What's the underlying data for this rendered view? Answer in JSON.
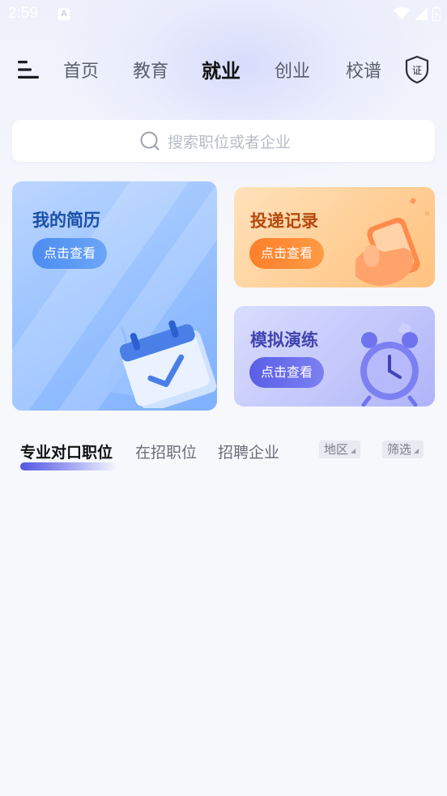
{
  "status_bar": {
    "time": "2:59",
    "notification_glyph": "A"
  },
  "nav": {
    "tabs": [
      {
        "label": "首页",
        "active": false
      },
      {
        "label": "教育",
        "active": false
      },
      {
        "label": "就业",
        "active": true
      },
      {
        "label": "创业",
        "active": false
      },
      {
        "label": "校谱",
        "active": false
      }
    ],
    "cert_label": "证"
  },
  "search": {
    "placeholder": "搜索职位或者企业"
  },
  "cards": {
    "resume": {
      "title": "我的简历",
      "button": "点击查看"
    },
    "delivery": {
      "title": "投递记录",
      "button": "点击查看"
    },
    "practice": {
      "title": "模拟演练",
      "button": "点击查看"
    }
  },
  "list_tabs": {
    "tabs": [
      {
        "label": "专业对口职位",
        "active": true
      },
      {
        "label": "在招职位",
        "active": false
      },
      {
        "label": "招聘企业",
        "active": false
      }
    ],
    "filters": {
      "region": "地区",
      "screen": "筛选"
    }
  },
  "colors": {
    "accent": "#5356e0",
    "resume_title": "#1b4fa6",
    "delivery_title": "#b44a10",
    "practice_title": "#4144b0"
  },
  "icons": [
    "menu-icon",
    "certificate-shield-icon",
    "search-icon",
    "calendar-check-icon",
    "phone-hand-icon",
    "alarm-clock-icon",
    "wifi-icon",
    "signal-icon",
    "battery-icon"
  ]
}
